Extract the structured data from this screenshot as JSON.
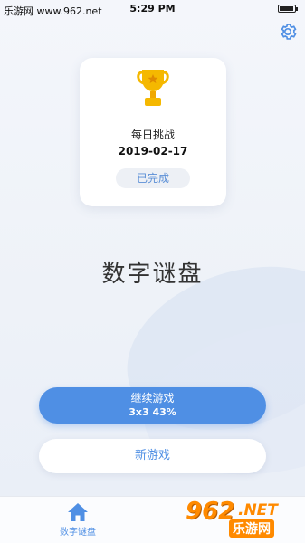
{
  "status_bar": {
    "time": "5:29 PM",
    "watermark": "乐游网 www.962.net"
  },
  "settings": {
    "icon": "gear-icon"
  },
  "daily_challenge": {
    "icon": "trophy-icon",
    "title": "每日挑战",
    "date": "2019-02-17",
    "status": "已完成"
  },
  "app_title": "数字谜盘",
  "continue_button": {
    "label": "继续游戏",
    "progress": "3x3 43%"
  },
  "new_game_button": {
    "label": "新游戏"
  },
  "tab_bar": {
    "items": [
      {
        "icon": "home-icon",
        "label": "数字谜盘"
      }
    ]
  },
  "watermark_logo": {
    "number": "962",
    "suffix": ".NET",
    "name": "乐游网"
  },
  "colors": {
    "accent": "#4f8fe4",
    "trophy": "#f5b800",
    "background": "#eef2f8"
  }
}
